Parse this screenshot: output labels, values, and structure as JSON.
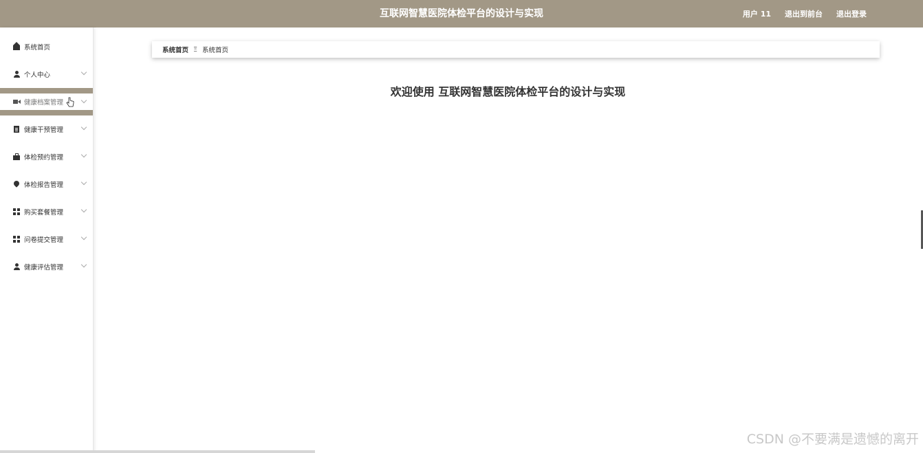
{
  "header": {
    "title": "互联网智慧医院体检平台的设计与实现",
    "user": "用户 11",
    "back_to_front": "退出到前台",
    "logout": "退出登录"
  },
  "sidebar": {
    "items": [
      {
        "label": "系统首页",
        "icon": "home-icon"
      },
      {
        "label": "个人中心",
        "icon": "user-icon"
      },
      {
        "label": "健康档案管理",
        "icon": "video-icon"
      },
      {
        "label": "健康干预管理",
        "icon": "clipboard-icon"
      },
      {
        "label": "体检预约管理",
        "icon": "briefcase-icon"
      },
      {
        "label": "体检报告管理",
        "icon": "map-pin-icon"
      },
      {
        "label": "购买套餐管理",
        "icon": "grid-icon"
      },
      {
        "label": "问卷提交管理",
        "icon": "grid-icon"
      },
      {
        "label": "健康评估管理",
        "icon": "user-icon"
      }
    ]
  },
  "breadcrumb": {
    "root": "系统首页",
    "separator": "Ξ",
    "current": "系统首页"
  },
  "main": {
    "welcome": "欢迎使用 互联网智慧医院体检平台的设计与实现"
  },
  "watermark": "CSDN @不要满是遗憾的离开",
  "colors": {
    "header_bg": "#a29886",
    "active_bg": "#a29886"
  }
}
